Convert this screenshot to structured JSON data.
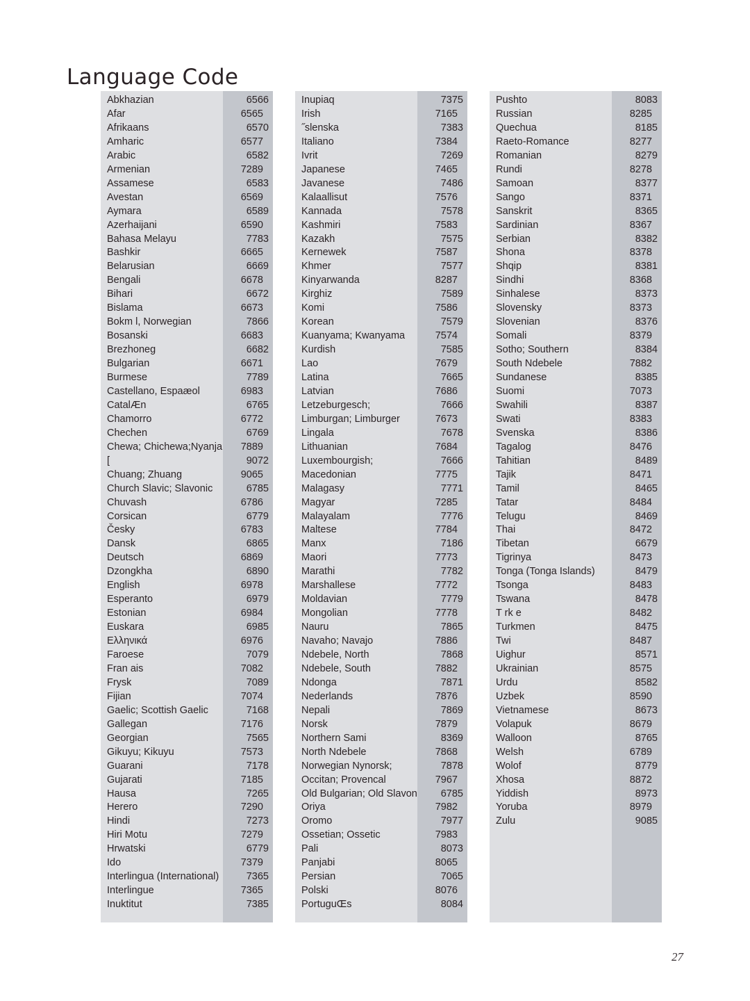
{
  "page": {
    "title": "Language Code",
    "page_number": "27",
    "colors": {
      "name_panel": "#dedfe2",
      "code_panel": "#c3c6cc",
      "text": "#2b2326",
      "background": "#ffffff"
    }
  },
  "columns": [
    {
      "id": "column-1",
      "rows": [
        {
          "name": "Abkhazian",
          "code": "6566"
        },
        {
          "name": "Afar",
          "code": "6565"
        },
        {
          "name": "Afrikaans",
          "code": "6570"
        },
        {
          "name": "Amharic",
          "code": "6577"
        },
        {
          "name": "Arabic",
          "code": "6582"
        },
        {
          "name": "Armenian",
          "code": "7289"
        },
        {
          "name": "Assamese",
          "code": "6583"
        },
        {
          "name": "Avestan",
          "code": "6569"
        },
        {
          "name": "Aymara",
          "code": "6589"
        },
        {
          "name": "Azerhaijani",
          "code": "6590"
        },
        {
          "name": "Bahasa Melayu",
          "code": "7783"
        },
        {
          "name": "Bashkir",
          "code": "6665"
        },
        {
          "name": "Belarusian",
          "code": "6669"
        },
        {
          "name": "Bengali",
          "code": "6678"
        },
        {
          "name": "Bihari",
          "code": "6672"
        },
        {
          "name": "Bislama",
          "code": "6673"
        },
        {
          "name": "Bokm l, Norwegian",
          "code": "7866"
        },
        {
          "name": "Bosanski",
          "code": "6683"
        },
        {
          "name": "Brezhoneg",
          "code": "6682"
        },
        {
          "name": "Bulgarian",
          "code": "6671"
        },
        {
          "name": "Burmese",
          "code": "7789"
        },
        {
          "name": "Castellano, Espaæol",
          "code": "6983"
        },
        {
          "name": "CatalÆn",
          "code": "6765"
        },
        {
          "name": "Chamorro",
          "code": "6772"
        },
        {
          "name": "Chechen",
          "code": "6769"
        },
        {
          "name": "Chewa; Chichewa;Nyanja",
          "code": "7889"
        },
        {
          "name": "[",
          "code": "9072"
        },
        {
          "name": "Chuang; Zhuang",
          "code": "9065"
        },
        {
          "name": "Church Slavic; Slavonic",
          "code": "6785"
        },
        {
          "name": "Chuvash",
          "code": "6786"
        },
        {
          "name": "Corsican",
          "code": "6779"
        },
        {
          "name": "Česky",
          "code": "6783"
        },
        {
          "name": "Dansk",
          "code": "6865"
        },
        {
          "name": "Deutsch",
          "code": "6869"
        },
        {
          "name": "Dzongkha",
          "code": "6890"
        },
        {
          "name": "English",
          "code": "6978"
        },
        {
          "name": "Esperanto",
          "code": "6979"
        },
        {
          "name": "Estonian",
          "code": "6984"
        },
        {
          "name": "Euskara",
          "code": "6985"
        },
        {
          "name": "Ελληνικά",
          "code": "6976"
        },
        {
          "name": "Faroese",
          "code": "7079"
        },
        {
          "name": "Fran ais",
          "code": "7082"
        },
        {
          "name": "Frysk",
          "code": "7089"
        },
        {
          "name": "Fijian",
          "code": "7074"
        },
        {
          "name": "Gaelic; Scottish Gaelic",
          "code": "7168"
        },
        {
          "name": "Gallegan",
          "code": "7176"
        },
        {
          "name": "Georgian",
          "code": "7565"
        },
        {
          "name": "Gikuyu; Kikuyu",
          "code": "7573"
        },
        {
          "name": "Guarani",
          "code": "7178"
        },
        {
          "name": "Gujarati",
          "code": "7185"
        },
        {
          "name": "Hausa",
          "code": "7265"
        },
        {
          "name": "Herero",
          "code": "7290"
        },
        {
          "name": "Hindi",
          "code": "7273"
        },
        {
          "name": "Hiri Motu",
          "code": "7279"
        },
        {
          "name": "Hrwatski",
          "code": "6779"
        },
        {
          "name": "Ido",
          "code": "7379"
        },
        {
          "name": "Interlingua (International)",
          "code": "7365"
        },
        {
          "name": "Interlingue",
          "code": "7365"
        },
        {
          "name": "Inuktitut",
          "code": "7385"
        }
      ]
    },
    {
      "id": "column-2",
      "rows": [
        {
          "name": "Inupiaq",
          "code": "7375"
        },
        {
          "name": "Irish",
          "code": "7165"
        },
        {
          "name": "˝slenska",
          "code": "7383"
        },
        {
          "name": "Italiano",
          "code": "7384"
        },
        {
          "name": "Ivrit",
          "code": "7269"
        },
        {
          "name": "Japanese",
          "code": "7465"
        },
        {
          "name": "Javanese",
          "code": "7486"
        },
        {
          "name": "Kalaallisut",
          "code": "7576"
        },
        {
          "name": "Kannada",
          "code": "7578"
        },
        {
          "name": "Kashmiri",
          "code": "7583"
        },
        {
          "name": "Kazakh",
          "code": "7575"
        },
        {
          "name": "Kernewek",
          "code": "7587"
        },
        {
          "name": "Khmer",
          "code": "7577"
        },
        {
          "name": "Kinyarwanda",
          "code": "8287"
        },
        {
          "name": "Kirghiz",
          "code": "7589"
        },
        {
          "name": "Komi",
          "code": "7586"
        },
        {
          "name": "Korean",
          "code": "7579"
        },
        {
          "name": "Kuanyama; Kwanyama",
          "code": "7574"
        },
        {
          "name": "Kurdish",
          "code": "7585"
        },
        {
          "name": "Lao",
          "code": "7679"
        },
        {
          "name": "Latina",
          "code": "7665"
        },
        {
          "name": "Latvian",
          "code": "7686"
        },
        {
          "name": "Letzeburgesch;",
          "code": "7666"
        },
        {
          "name": "Limburgan; Limburger",
          "code": "7673"
        },
        {
          "name": "Lingala",
          "code": "7678"
        },
        {
          "name": "Lithuanian",
          "code": "7684"
        },
        {
          "name": "Luxembourgish;",
          "code": "7666"
        },
        {
          "name": "Macedonian",
          "code": "7775"
        },
        {
          "name": "Malagasy",
          "code": "7771"
        },
        {
          "name": "Magyar",
          "code": "7285"
        },
        {
          "name": "Malayalam",
          "code": "7776"
        },
        {
          "name": "Maltese",
          "code": "7784"
        },
        {
          "name": "Manx",
          "code": "7186"
        },
        {
          "name": "Maori",
          "code": "7773"
        },
        {
          "name": "Marathi",
          "code": "7782"
        },
        {
          "name": "Marshallese",
          "code": "7772"
        },
        {
          "name": "Moldavian",
          "code": "7779"
        },
        {
          "name": "Mongolian",
          "code": "7778"
        },
        {
          "name": "Nauru",
          "code": "7865"
        },
        {
          "name": "Navaho; Navajo",
          "code": "7886"
        },
        {
          "name": "Ndebele, North",
          "code": "7868"
        },
        {
          "name": "Ndebele, South",
          "code": "7882"
        },
        {
          "name": "Ndonga",
          "code": "7871"
        },
        {
          "name": "Nederlands",
          "code": "7876"
        },
        {
          "name": "Nepali",
          "code": "7869"
        },
        {
          "name": "Norsk",
          "code": "7879"
        },
        {
          "name": "Northern Sami",
          "code": "8369"
        },
        {
          "name": "North Ndebele",
          "code": "7868"
        },
        {
          "name": "Norwegian Nynorsk;",
          "code": "7878"
        },
        {
          "name": "Occitan; Provencal",
          "code": "7967"
        },
        {
          "name": "Old Bulgarian; Old Slavonic",
          "code": "6785"
        },
        {
          "name": "Oriya",
          "code": "7982"
        },
        {
          "name": "Oromo",
          "code": "7977"
        },
        {
          "name": "Ossetian; Ossetic",
          "code": "7983"
        },
        {
          "name": "Pali",
          "code": "8073"
        },
        {
          "name": "Panjabi",
          "code": "8065"
        },
        {
          "name": "Persian",
          "code": "7065"
        },
        {
          "name": "Polski",
          "code": "8076"
        },
        {
          "name": "PortuguŒs",
          "code": "8084"
        }
      ]
    },
    {
      "id": "column-3",
      "rows": [
        {
          "name": "Pushto",
          "code": "8083"
        },
        {
          "name": "Russian",
          "code": "8285"
        },
        {
          "name": "Quechua",
          "code": "8185"
        },
        {
          "name": "Raeto-Romance",
          "code": "8277"
        },
        {
          "name": "Romanian",
          "code": "8279"
        },
        {
          "name": "Rundi",
          "code": "8278"
        },
        {
          "name": "Samoan",
          "code": "8377"
        },
        {
          "name": "Sango",
          "code": "8371"
        },
        {
          "name": "Sanskrit",
          "code": "8365"
        },
        {
          "name": "Sardinian",
          "code": "8367"
        },
        {
          "name": "Serbian",
          "code": "8382"
        },
        {
          "name": "Shona",
          "code": "8378"
        },
        {
          "name": "Shqip",
          "code": "8381"
        },
        {
          "name": "Sindhi",
          "code": "8368"
        },
        {
          "name": "Sinhalese",
          "code": "8373"
        },
        {
          "name": "Slovensky",
          "code": "8373"
        },
        {
          "name": "Slovenian",
          "code": "8376"
        },
        {
          "name": "Somali",
          "code": "8379"
        },
        {
          "name": "Sotho; Southern",
          "code": "8384"
        },
        {
          "name": "South Ndebele",
          "code": "7882"
        },
        {
          "name": "Sundanese",
          "code": "8385"
        },
        {
          "name": "Suomi",
          "code": "7073"
        },
        {
          "name": "Swahili",
          "code": "8387"
        },
        {
          "name": "Swati",
          "code": "8383"
        },
        {
          "name": "Svenska",
          "code": "8386"
        },
        {
          "name": "Tagalog",
          "code": "8476"
        },
        {
          "name": "Tahitian",
          "code": "8489"
        },
        {
          "name": "Tajik",
          "code": "8471"
        },
        {
          "name": "Tamil",
          "code": "8465"
        },
        {
          "name": "Tatar",
          "code": "8484"
        },
        {
          "name": "Telugu",
          "code": "8469"
        },
        {
          "name": "Thai",
          "code": "8472"
        },
        {
          "name": "Tibetan",
          "code": "6679"
        },
        {
          "name": "Tigrinya",
          "code": "8473"
        },
        {
          "name": "Tonga (Tonga Islands)",
          "code": "8479"
        },
        {
          "name": "Tsonga",
          "code": "8483"
        },
        {
          "name": "Tswana",
          "code": "8478"
        },
        {
          "name": "T rk e",
          "code": "8482"
        },
        {
          "name": "Turkmen",
          "code": "8475"
        },
        {
          "name": "Twi",
          "code": "8487"
        },
        {
          "name": "Uighur",
          "code": "8571"
        },
        {
          "name": "Ukrainian",
          "code": "8575"
        },
        {
          "name": "Urdu",
          "code": "8582"
        },
        {
          "name": "Uzbek",
          "code": "8590"
        },
        {
          "name": "Vietnamese",
          "code": "8673"
        },
        {
          "name": "Volapuk",
          "code": "8679"
        },
        {
          "name": "Walloon",
          "code": "8765"
        },
        {
          "name": "Welsh",
          "code": "6789"
        },
        {
          "name": "Wolof",
          "code": "8779"
        },
        {
          "name": "Xhosa",
          "code": "8872"
        },
        {
          "name": "Yiddish",
          "code": "8973"
        },
        {
          "name": "Yoruba",
          "code": "8979"
        },
        {
          "name": "Zulu",
          "code": "9085"
        }
      ]
    }
  ]
}
